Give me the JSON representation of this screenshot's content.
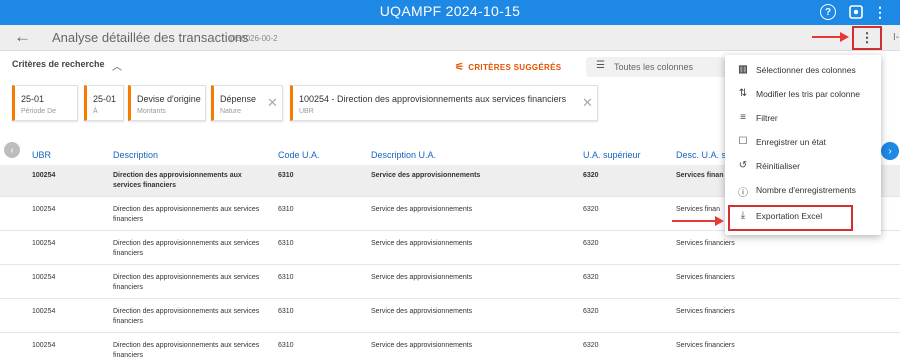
{
  "app": {
    "title": "UQAMPF 2024-10-15"
  },
  "header": {
    "title": "Analyse détaillée des transactions",
    "code": "DB0026-00-2",
    "edge_text": "I-"
  },
  "criteria": {
    "label": "Critères de recherche",
    "suggested": "CRITÈRES SUGGÉRÉS",
    "columns_placeholder": "Toutes les colonnes",
    "chips": [
      {
        "value": "25-01",
        "label": "Période De"
      },
      {
        "value": "25-01",
        "label": "À"
      },
      {
        "value": "Devise d'origine",
        "label": "Montants"
      },
      {
        "value": "Dépense",
        "label": "Nature"
      },
      {
        "value": "100254 - Direction des approvisionnements aux services financiers",
        "label": "UBR"
      }
    ]
  },
  "table": {
    "headers": [
      "UBR",
      "Description",
      "Code U.A.",
      "Description U.A.",
      "U.A. supérieur",
      "Desc. U.A. s"
    ],
    "rows": [
      [
        "100254",
        "Direction des approvisionnements aux services financiers",
        "6310",
        "Service des approvisionnements",
        "6320",
        "Services finan"
      ],
      [
        "100254",
        "Direction des approvisionnements aux services financiers",
        "6310",
        "Service des approvisionnements",
        "6320",
        "Services finan"
      ],
      [
        "100254",
        "Direction des approvisionnements aux services financiers",
        "6310",
        "Service des approvisionnements",
        "6320",
        "Services financiers"
      ],
      [
        "100254",
        "Direction des approvisionnements aux services financiers",
        "6310",
        "Service des approvisionnements",
        "6320",
        "Services financiers"
      ],
      [
        "100254",
        "Direction des approvisionnements aux services financiers",
        "6310",
        "Service des approvisionnements",
        "6320",
        "Services financiers"
      ],
      [
        "100254",
        "Direction des approvisionnements aux services financiers",
        "6310",
        "Service des approvisionnements",
        "6320",
        "Services financiers"
      ]
    ]
  },
  "menu": {
    "items": [
      {
        "label": "Sélectionner des colonnes",
        "icon": "columns-icon"
      },
      {
        "label": "Modifier les tris par colonne",
        "icon": "sort-icon"
      },
      {
        "label": "Filtrer",
        "icon": "filter-icon"
      },
      {
        "label": "Enregistrer un état",
        "icon": "bookmark-icon"
      },
      {
        "label": "Réinitialiser",
        "icon": "reset-icon"
      },
      {
        "label": "Nombre d'enregistrements",
        "icon": "info-icon"
      },
      {
        "label": "Exportation Excel",
        "icon": "download-icon"
      }
    ]
  },
  "colors": {
    "primary": "#1e88e5",
    "accent": "#f57c00",
    "annotation": "#e53935"
  }
}
